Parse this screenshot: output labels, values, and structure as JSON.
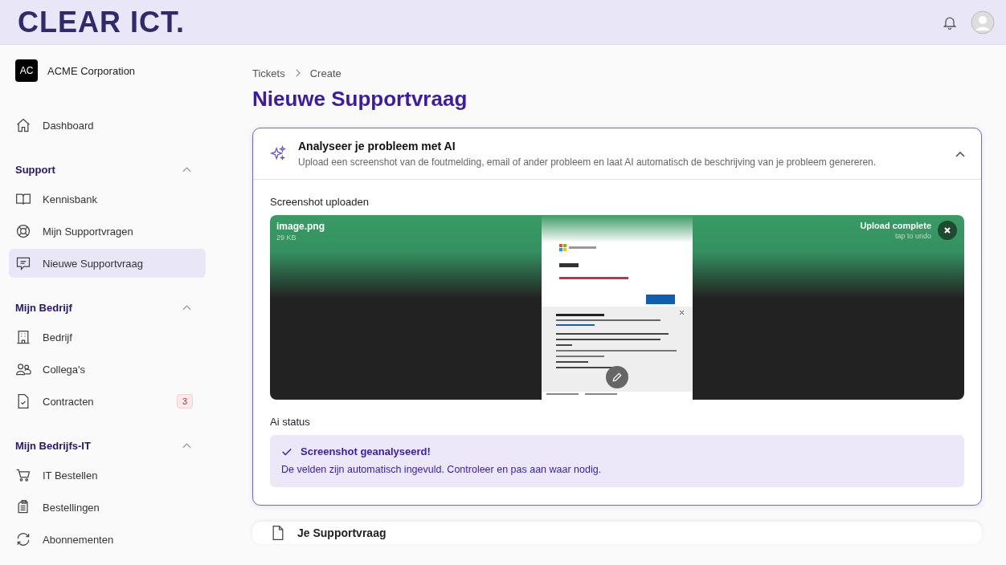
{
  "header": {
    "logo": "CLEAR ICT."
  },
  "org": {
    "initials": "AC",
    "name": "ACME Corporation"
  },
  "dashboard": {
    "label": "Dashboard",
    "selected": false
  },
  "sections": [
    {
      "title": "Support",
      "expanded": true,
      "items": [
        {
          "label": "Kennisbank",
          "selected": false
        },
        {
          "label": "Mijn Supportvragen",
          "selected": false
        },
        {
          "label": "Nieuwe Supportvraag",
          "selected": true
        }
      ]
    },
    {
      "title": "Mijn Bedrijf",
      "expanded": true,
      "items": [
        {
          "label": "Bedrijf",
          "selected": false
        },
        {
          "label": "Collega's",
          "selected": false
        },
        {
          "label": "Contracten",
          "selected": false,
          "badge": "3"
        }
      ]
    },
    {
      "title": "Mijn Bedrijfs-IT",
      "expanded": true,
      "items": [
        {
          "label": "IT Bestellen",
          "selected": false
        },
        {
          "label": "Bestellingen",
          "selected": false
        },
        {
          "label": "Abonnementen",
          "selected": false
        }
      ]
    }
  ],
  "breadcrumb": [
    "Tickets",
    "Create"
  ],
  "title": "Nieuwe Supportvraag",
  "ai_card": {
    "title": "Analyseer je probleem met AI",
    "description": "Upload een screenshot van de foutmelding, email of ander probleem en laat AI automatisch de beschrijving van je probleem genereren.",
    "expanded": true,
    "upload_label": "Screenshot uploaden",
    "file": {
      "name": "image.png",
      "size": "29 KB",
      "status": "Upload complete",
      "hint": "tap to undo"
    },
    "status_label": "Ai status",
    "status": {
      "title": "Screenshot geanalyseerd!",
      "message": "De velden zijn automatisch ingevuld. Controleer en pas aan waar nodig."
    }
  },
  "next_card": {
    "title": "Je Supportvraag"
  }
}
